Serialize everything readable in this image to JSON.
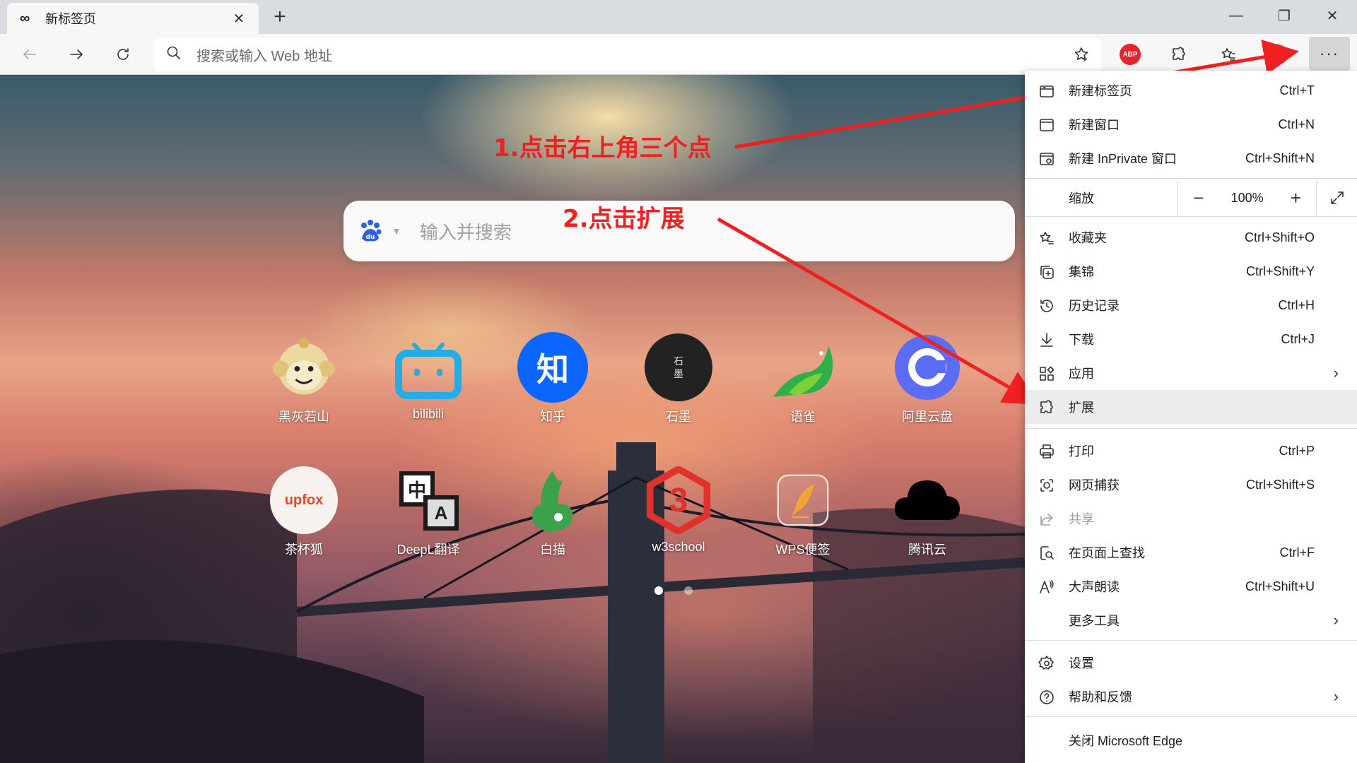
{
  "tab": {
    "title": "新标签页",
    "icon": "infinity-icon"
  },
  "toolbar": {
    "address_placeholder": "搜索或输入 Web 地址",
    "abp_label": "ABP"
  },
  "search": {
    "placeholder": "输入并搜索",
    "engine": "baidu"
  },
  "shortcuts": [
    {
      "label": "黑灰若山",
      "color": "#e9c98a"
    },
    {
      "label": "bilibili",
      "color": "#23ade5"
    },
    {
      "label": "知乎",
      "color": "#0a66ff"
    },
    {
      "label": "石墨",
      "color": "#222222"
    },
    {
      "label": "语雀",
      "color": "#2eaf4a"
    },
    {
      "label": "阿里云盘",
      "color": "#5b6cf5"
    },
    {
      "label": "茶杯狐",
      "color": "#f06a44"
    },
    {
      "label": "DeepL翻译",
      "color": "#1b1b1b"
    },
    {
      "label": "白描",
      "color": "#3aa24a"
    },
    {
      "label": "w3school",
      "color": "#e0322b"
    },
    {
      "label": "WPS便签",
      "color": "#f2a533"
    },
    {
      "label": "腾讯云",
      "color": "#000000"
    }
  ],
  "shortcut_text": {
    "shimo": "石\n墨",
    "zhihu": "知",
    "upfox": "upfox",
    "deepl_zh": "中",
    "deepl_a": "A",
    "w3": "3"
  },
  "annotations": {
    "step1": "1.点击右上角三个点",
    "step2": "2.点击扩展"
  },
  "menu": {
    "new_tab": {
      "label": "新建标签页",
      "shortcut": "Ctrl+T"
    },
    "new_window": {
      "label": "新建窗口",
      "shortcut": "Ctrl+N"
    },
    "new_inprivate": {
      "label": "新建 InPrivate 窗口",
      "shortcut": "Ctrl+Shift+N"
    },
    "zoom": {
      "label": "缩放",
      "value": "100%"
    },
    "favorites": {
      "label": "收藏夹",
      "shortcut": "Ctrl+Shift+O"
    },
    "collections": {
      "label": "集锦",
      "shortcut": "Ctrl+Shift+Y"
    },
    "history": {
      "label": "历史记录",
      "shortcut": "Ctrl+H"
    },
    "downloads": {
      "label": "下载",
      "shortcut": "Ctrl+J"
    },
    "apps": {
      "label": "应用"
    },
    "extensions": {
      "label": "扩展"
    },
    "print": {
      "label": "打印",
      "shortcut": "Ctrl+P"
    },
    "web_capture": {
      "label": "网页捕获",
      "shortcut": "Ctrl+Shift+S"
    },
    "share": {
      "label": "共享"
    },
    "find": {
      "label": "在页面上查找",
      "shortcut": "Ctrl+F"
    },
    "read_aloud": {
      "label": "大声朗读",
      "shortcut": "Ctrl+Shift+U"
    },
    "more_tools": {
      "label": "更多工具"
    },
    "settings": {
      "label": "设置"
    },
    "help": {
      "label": "帮助和反馈"
    },
    "close": {
      "label": "关闭 Microsoft Edge"
    }
  }
}
